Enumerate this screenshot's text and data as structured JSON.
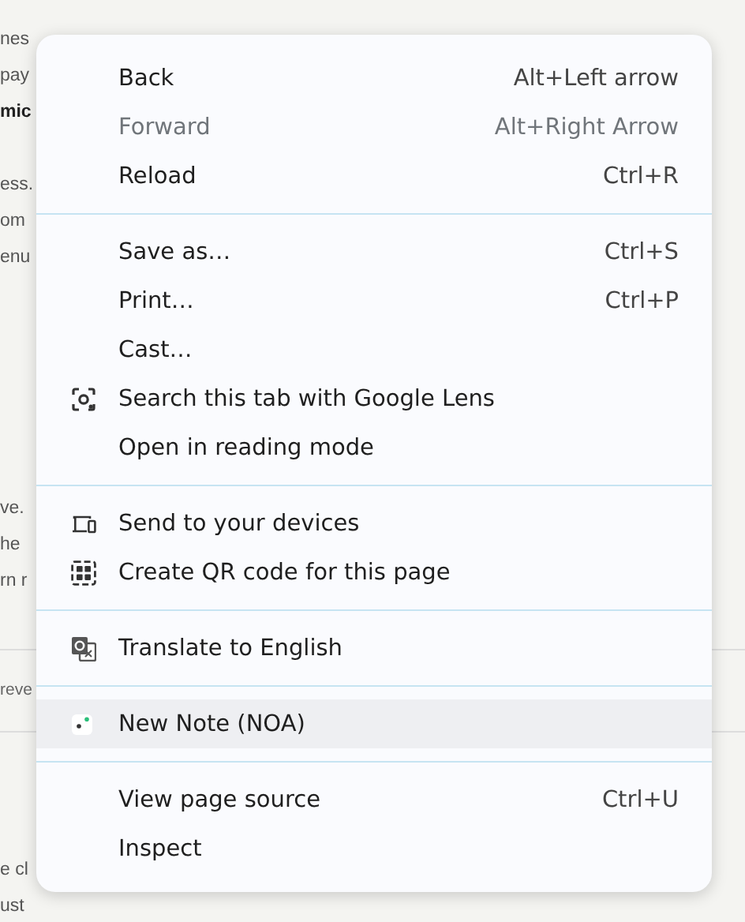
{
  "background": {
    "paragraphs": [
      {
        "lines": [
          {
            "text": "nes",
            "bold": false
          },
          {
            "text": "pay",
            "bold": false
          },
          {
            "text": "mic",
            "bold": true
          }
        ]
      },
      {
        "lines": [
          {
            "text": "ess.",
            "bold": false
          },
          {
            "text": "om",
            "bold": false
          },
          {
            "text": "enu",
            "bold": false
          }
        ]
      },
      {
        "lines": [
          {
            "text": "ve.",
            "bold": false
          },
          {
            "text": "he",
            "bold": false
          },
          {
            "text": "rn r",
            "bold": false
          }
        ]
      },
      {
        "lines": [
          {
            "text": "reve",
            "bold": false
          }
        ]
      },
      {
        "lines": [
          {
            "text": "e cl",
            "bold": false
          },
          {
            "text": "ust",
            "bold": false
          }
        ]
      }
    ]
  },
  "menu": {
    "groups": [
      {
        "items": [
          {
            "kind": "plain",
            "label": "Back",
            "shortcut": "Alt+Left arrow",
            "disabled": false,
            "selected": false
          },
          {
            "kind": "plain",
            "label": "Forward",
            "shortcut": "Alt+Right Arrow",
            "disabled": true,
            "selected": false
          },
          {
            "kind": "plain",
            "label": "Reload",
            "shortcut": "Ctrl+R",
            "disabled": false,
            "selected": false
          }
        ]
      },
      {
        "items": [
          {
            "kind": "plain",
            "label": "Save as…",
            "shortcut": "Ctrl+S",
            "disabled": false,
            "selected": false
          },
          {
            "kind": "plain",
            "label": "Print…",
            "shortcut": "Ctrl+P",
            "disabled": false,
            "selected": false
          },
          {
            "kind": "plain",
            "label": "Cast…",
            "disabled": false,
            "selected": false
          },
          {
            "kind": "lens",
            "label": "Search this tab with Google Lens",
            "disabled": false,
            "selected": false
          },
          {
            "kind": "plain",
            "label": "Open in reading mode",
            "disabled": false,
            "selected": false
          }
        ]
      },
      {
        "items": [
          {
            "kind": "devices",
            "label": "Send to your devices",
            "disabled": false,
            "selected": false
          },
          {
            "kind": "qr",
            "label": "Create QR code for this page",
            "disabled": false,
            "selected": false
          }
        ]
      },
      {
        "items": [
          {
            "kind": "translate",
            "label": "Translate to English",
            "disabled": false,
            "selected": false
          }
        ]
      },
      {
        "items": [
          {
            "kind": "note",
            "label": "New Note (NOA)",
            "disabled": false,
            "selected": true
          }
        ]
      },
      {
        "items": [
          {
            "kind": "plain",
            "label": "View page source",
            "shortcut": "Ctrl+U",
            "disabled": false,
            "selected": false
          },
          {
            "kind": "plain",
            "label": "Inspect",
            "disabled": false,
            "selected": false
          }
        ]
      }
    ]
  }
}
